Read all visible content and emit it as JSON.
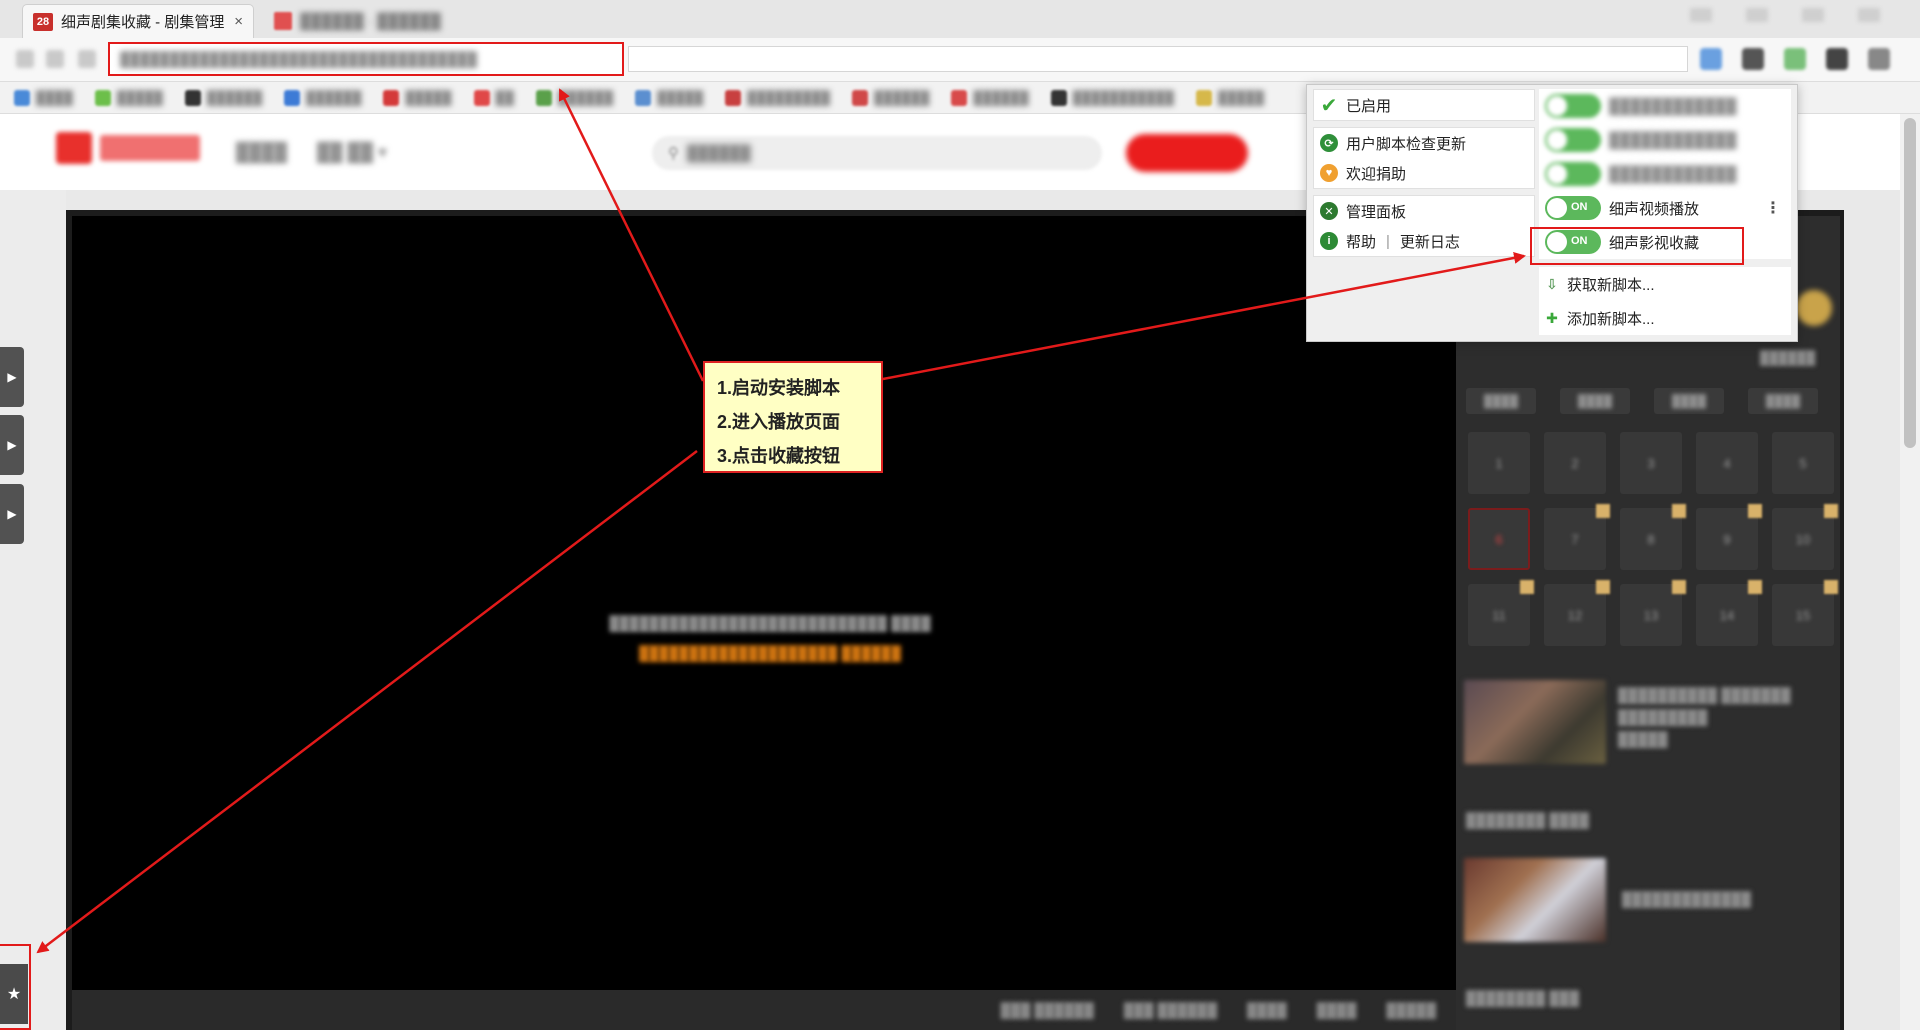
{
  "browser": {
    "active_tab": {
      "favicon_text": "28",
      "title": "细声剧集收藏 - 剧集管理",
      "close": "×"
    },
    "inactive_tab": {
      "title": "██████ · ██████"
    },
    "address_bar": {
      "url": "████████████████████████████████████"
    },
    "bookmarks": [
      "████",
      "█████",
      "██████",
      "██████",
      "█████",
      "██",
      "██████",
      "█████",
      "█████████",
      "██████",
      "██████",
      "███████████",
      "█████"
    ]
  },
  "site": {
    "search_placeholder": "██████",
    "search_button": "████",
    "nav": [
      "████",
      "██ ██ ▾"
    ]
  },
  "video": {
    "message_line1": "████████████████████████████ ████",
    "message_line2": "████████████████████ ██████",
    "controls": [
      "███ ██████",
      "███ ██████",
      "████",
      "████",
      "█████"
    ]
  },
  "side_panel": {
    "subtitle": "██████",
    "tabs": [
      "████",
      "████",
      "████",
      "████"
    ],
    "episodes": [
      "1",
      "2",
      "3",
      "4",
      "5",
      "6",
      "7",
      "8",
      "9",
      "10",
      "11",
      "12",
      "13",
      "14",
      "15"
    ],
    "recommendations": [
      {
        "title_line1": "██████████ ███████",
        "title_line2": "█████████",
        "meta": "█████"
      },
      {
        "title_line1": "█████████████",
        "title_line2": "",
        "meta": ""
      }
    ],
    "section_labels": [
      "████████ ████",
      "████████ ███"
    ]
  },
  "sidebar_buttons": {
    "arrow": "▶",
    "favorite": "★"
  },
  "script_menu": {
    "enabled_label": "已启用",
    "check_update_label": "用户脚本检查更新",
    "donate_label": "欢迎捐助",
    "dashboard_label": "管理面板",
    "help_label": "帮助",
    "changelog_label": "更新日志",
    "help_separator": "|",
    "blurred_scripts": [
      "████████████",
      "████████████",
      "████████████"
    ],
    "scripts": [
      {
        "name": "细声视频播放",
        "toggle": "ON"
      },
      {
        "name": "细声影视收藏",
        "toggle": "ON"
      }
    ],
    "get_new_script": "获取新脚本...",
    "add_new_script": "添加新脚本..."
  },
  "annotation": {
    "steps": [
      "1.启动安装脚本",
      "2.进入播放页面",
      "3.点击收藏按钮"
    ]
  },
  "colors": {
    "accent_red": "#e21a1a",
    "toggle_green": "#5cb85c",
    "callout_bg": "#ffffc4"
  }
}
